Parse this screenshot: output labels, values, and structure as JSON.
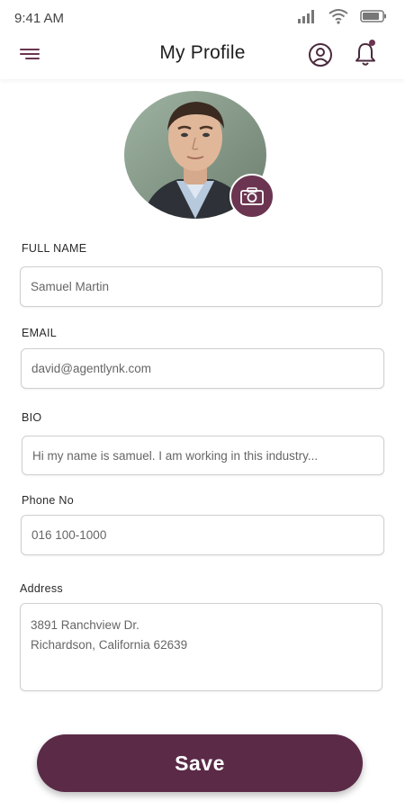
{
  "status_bar": {
    "time": "9:41 AM"
  },
  "header": {
    "title": "My Profile",
    "menu_icon": "hamburger-menu-icon",
    "profile_icon": "user-circle-icon",
    "notification_icon": "bell-icon"
  },
  "avatar": {
    "camera_icon": "camera-icon"
  },
  "form": {
    "full_name": {
      "label": "FULL NAME",
      "value": "Samuel Martin"
    },
    "email": {
      "label": "EMAIL",
      "value": "david@agentlynk.com"
    },
    "bio": {
      "label": "BIO",
      "value": "Hi my name is samuel. I am working in this industry..."
    },
    "phone": {
      "label": "Phone No",
      "value": "016 100-1000"
    },
    "address": {
      "label": "Address",
      "value": "3891 Ranchview Dr.\nRichardson, California 62639"
    }
  },
  "save_label": "Save",
  "colors": {
    "accent": "#5b2a47",
    "camera_bg": "#6b3450"
  }
}
